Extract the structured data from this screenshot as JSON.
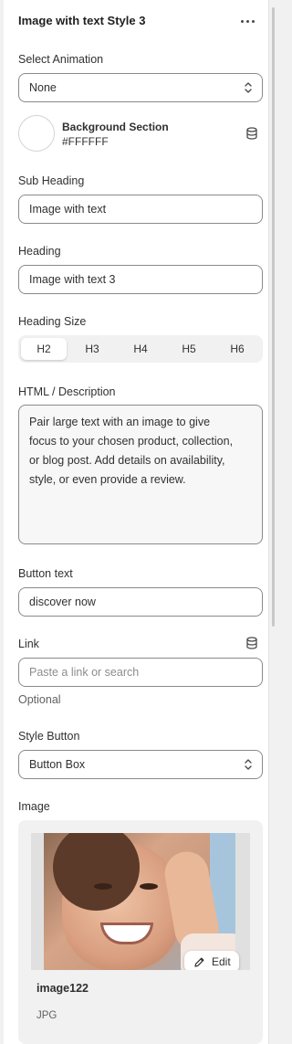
{
  "panel": {
    "title": "Image with text Style 3",
    "more_icon": "more-horizontal-icon"
  },
  "select_animation": {
    "label": "Select Animation",
    "value": "None"
  },
  "background": {
    "title": "Background Section",
    "value": "#FFFFFF",
    "swatch_color": "#FFFFFF",
    "icon": "database-icon"
  },
  "sub_heading": {
    "label": "Sub Heading",
    "value": "Image with text"
  },
  "heading": {
    "label": "Heading",
    "value": "Image with text 3"
  },
  "heading_size": {
    "label": "Heading Size",
    "options": [
      "H2",
      "H3",
      "H4",
      "H5",
      "H6"
    ],
    "selected": "H2"
  },
  "description": {
    "label": "HTML / Description",
    "lines": [
      "Pair large text with an image to give",
      "focus to your chosen product, collection,",
      "or blog post. Add details on availability,",
      "style, or even provide a review."
    ]
  },
  "button_text": {
    "label": "Button text",
    "value": "discover now"
  },
  "link": {
    "label": "Link",
    "placeholder": "Paste a link or search",
    "helper": "Optional",
    "icon": "database-icon"
  },
  "style_button": {
    "label": "Style Button",
    "value": "Button Box"
  },
  "image": {
    "label": "Image",
    "name": "image122",
    "type": "JPG",
    "edit_label": "Edit",
    "edit_icon": "pencil-icon"
  }
}
